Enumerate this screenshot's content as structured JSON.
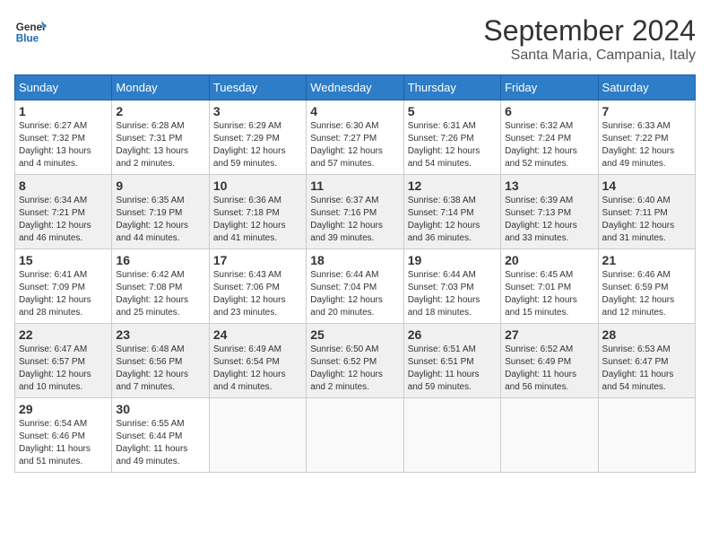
{
  "logo": {
    "line1": "General",
    "line2": "Blue"
  },
  "title": "September 2024",
  "location": "Santa Maria, Campania, Italy",
  "days_of_week": [
    "Sunday",
    "Monday",
    "Tuesday",
    "Wednesday",
    "Thursday",
    "Friday",
    "Saturday"
  ],
  "weeks": [
    [
      {
        "day": 1,
        "info": "Sunrise: 6:27 AM\nSunset: 7:32 PM\nDaylight: 13 hours\nand 4 minutes."
      },
      {
        "day": 2,
        "info": "Sunrise: 6:28 AM\nSunset: 7:31 PM\nDaylight: 13 hours\nand 2 minutes."
      },
      {
        "day": 3,
        "info": "Sunrise: 6:29 AM\nSunset: 7:29 PM\nDaylight: 12 hours\nand 59 minutes."
      },
      {
        "day": 4,
        "info": "Sunrise: 6:30 AM\nSunset: 7:27 PM\nDaylight: 12 hours\nand 57 minutes."
      },
      {
        "day": 5,
        "info": "Sunrise: 6:31 AM\nSunset: 7:26 PM\nDaylight: 12 hours\nand 54 minutes."
      },
      {
        "day": 6,
        "info": "Sunrise: 6:32 AM\nSunset: 7:24 PM\nDaylight: 12 hours\nand 52 minutes."
      },
      {
        "day": 7,
        "info": "Sunrise: 6:33 AM\nSunset: 7:22 PM\nDaylight: 12 hours\nand 49 minutes."
      }
    ],
    [
      {
        "day": 8,
        "info": "Sunrise: 6:34 AM\nSunset: 7:21 PM\nDaylight: 12 hours\nand 46 minutes."
      },
      {
        "day": 9,
        "info": "Sunrise: 6:35 AM\nSunset: 7:19 PM\nDaylight: 12 hours\nand 44 minutes."
      },
      {
        "day": 10,
        "info": "Sunrise: 6:36 AM\nSunset: 7:18 PM\nDaylight: 12 hours\nand 41 minutes."
      },
      {
        "day": 11,
        "info": "Sunrise: 6:37 AM\nSunset: 7:16 PM\nDaylight: 12 hours\nand 39 minutes."
      },
      {
        "day": 12,
        "info": "Sunrise: 6:38 AM\nSunset: 7:14 PM\nDaylight: 12 hours\nand 36 minutes."
      },
      {
        "day": 13,
        "info": "Sunrise: 6:39 AM\nSunset: 7:13 PM\nDaylight: 12 hours\nand 33 minutes."
      },
      {
        "day": 14,
        "info": "Sunrise: 6:40 AM\nSunset: 7:11 PM\nDaylight: 12 hours\nand 31 minutes."
      }
    ],
    [
      {
        "day": 15,
        "info": "Sunrise: 6:41 AM\nSunset: 7:09 PM\nDaylight: 12 hours\nand 28 minutes."
      },
      {
        "day": 16,
        "info": "Sunrise: 6:42 AM\nSunset: 7:08 PM\nDaylight: 12 hours\nand 25 minutes."
      },
      {
        "day": 17,
        "info": "Sunrise: 6:43 AM\nSunset: 7:06 PM\nDaylight: 12 hours\nand 23 minutes."
      },
      {
        "day": 18,
        "info": "Sunrise: 6:44 AM\nSunset: 7:04 PM\nDaylight: 12 hours\nand 20 minutes."
      },
      {
        "day": 19,
        "info": "Sunrise: 6:44 AM\nSunset: 7:03 PM\nDaylight: 12 hours\nand 18 minutes."
      },
      {
        "day": 20,
        "info": "Sunrise: 6:45 AM\nSunset: 7:01 PM\nDaylight: 12 hours\nand 15 minutes."
      },
      {
        "day": 21,
        "info": "Sunrise: 6:46 AM\nSunset: 6:59 PM\nDaylight: 12 hours\nand 12 minutes."
      }
    ],
    [
      {
        "day": 22,
        "info": "Sunrise: 6:47 AM\nSunset: 6:57 PM\nDaylight: 12 hours\nand 10 minutes."
      },
      {
        "day": 23,
        "info": "Sunrise: 6:48 AM\nSunset: 6:56 PM\nDaylight: 12 hours\nand 7 minutes."
      },
      {
        "day": 24,
        "info": "Sunrise: 6:49 AM\nSunset: 6:54 PM\nDaylight: 12 hours\nand 4 minutes."
      },
      {
        "day": 25,
        "info": "Sunrise: 6:50 AM\nSunset: 6:52 PM\nDaylight: 12 hours\nand 2 minutes."
      },
      {
        "day": 26,
        "info": "Sunrise: 6:51 AM\nSunset: 6:51 PM\nDaylight: 11 hours\nand 59 minutes."
      },
      {
        "day": 27,
        "info": "Sunrise: 6:52 AM\nSunset: 6:49 PM\nDaylight: 11 hours\nand 56 minutes."
      },
      {
        "day": 28,
        "info": "Sunrise: 6:53 AM\nSunset: 6:47 PM\nDaylight: 11 hours\nand 54 minutes."
      }
    ],
    [
      {
        "day": 29,
        "info": "Sunrise: 6:54 AM\nSunset: 6:46 PM\nDaylight: 11 hours\nand 51 minutes."
      },
      {
        "day": 30,
        "info": "Sunrise: 6:55 AM\nSunset: 6:44 PM\nDaylight: 11 hours\nand 49 minutes."
      },
      {
        "day": null,
        "info": ""
      },
      {
        "day": null,
        "info": ""
      },
      {
        "day": null,
        "info": ""
      },
      {
        "day": null,
        "info": ""
      },
      {
        "day": null,
        "info": ""
      }
    ]
  ]
}
